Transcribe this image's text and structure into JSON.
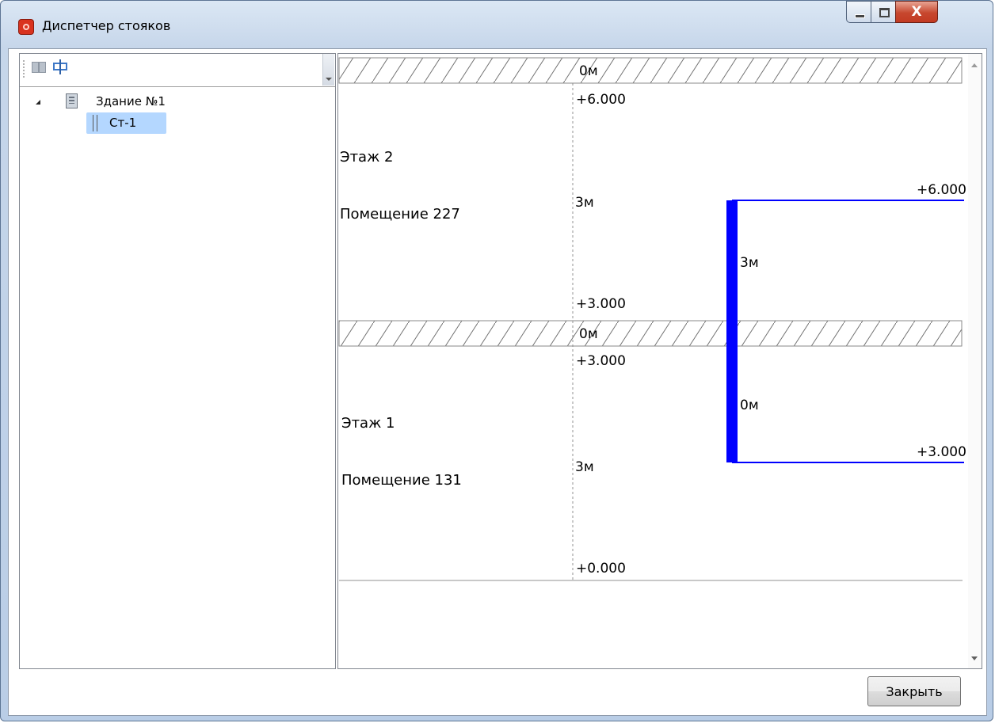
{
  "window": {
    "title": "Диспетчер стояков",
    "controls": {
      "minimize_icon": "minimize-icon",
      "maximize_icon": "maximize-icon",
      "close_glyph": "X"
    }
  },
  "toolbar": {
    "buttons": [
      {
        "icon": "find-icon"
      },
      {
        "icon": "edit-riser-icon"
      }
    ]
  },
  "tree": {
    "building": {
      "label": "Здание №1",
      "icon": "building-icon",
      "expanded": true
    },
    "riser": {
      "label": "Ст-1",
      "icon": "riser-icon",
      "selected": true
    }
  },
  "diagram": {
    "floors": [
      {
        "name": "Этаж 2",
        "room": "Помещение 227",
        "top_mark": "+6.000",
        "bottom_mark": "+3.000",
        "height_label": "3м"
      },
      {
        "name": "Этаж 1",
        "room": "Помещение 131",
        "top_mark": "+3.000",
        "bottom_mark": "+0.000",
        "height_label": "3м"
      }
    ],
    "slabs": [
      {
        "label": "0м"
      },
      {
        "label": "0м"
      }
    ],
    "riser": {
      "color": "#0000ff",
      "top_mark": "+6.000",
      "bottom_mark": "+3.000",
      "upper_segment_label": "3м",
      "lower_segment_label": "0м"
    }
  },
  "footer": {
    "close_button": "Закрыть"
  }
}
